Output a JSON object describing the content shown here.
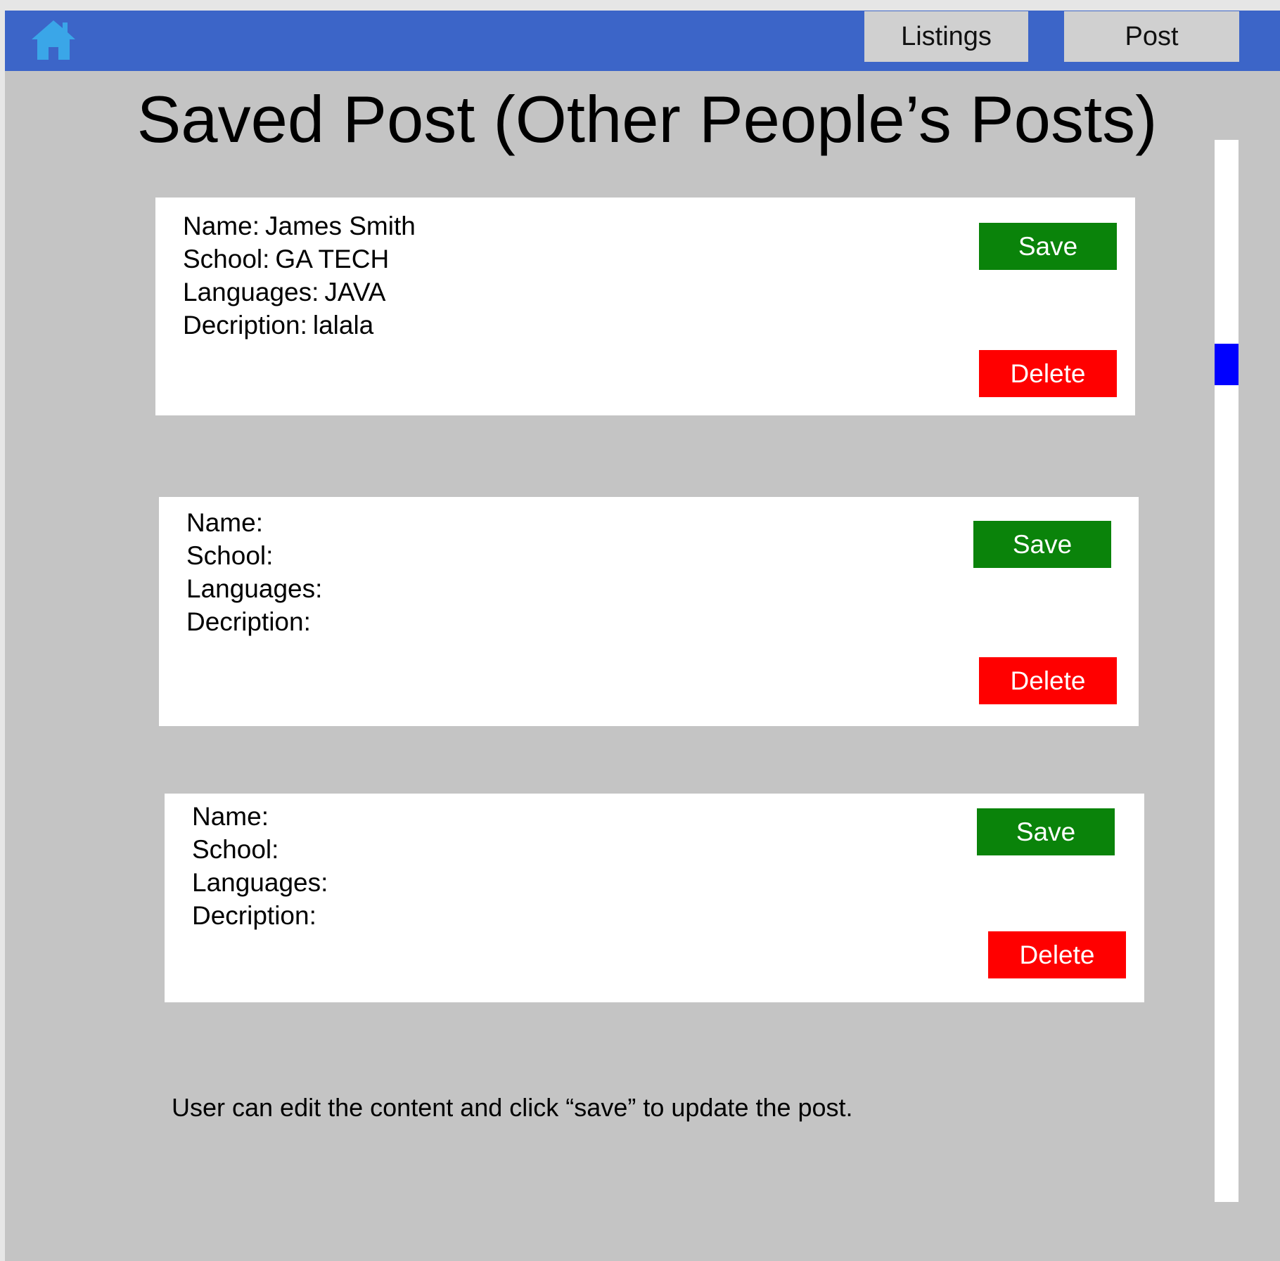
{
  "navbar": {
    "home_icon": "home-icon",
    "listings_label": "Listings",
    "post_label": "Post",
    "colors": {
      "bar": "#3c65c8",
      "button": "#d0d0d0",
      "home_icon": "#3aa6e8"
    }
  },
  "page": {
    "title": "Saved Post (Other People’s Posts)",
    "background": "#c4c4c4"
  },
  "posts": [
    {
      "fields": [
        {
          "label": "Name:",
          "value": "James Smith"
        },
        {
          "label": "School:",
          "value": "GA TECH"
        },
        {
          "label": "Languages:",
          "value": "JAVA"
        },
        {
          "label": "Decription:",
          "value": "lalala"
        }
      ],
      "save_label": "Save",
      "delete_label": "Delete"
    },
    {
      "fields": [
        {
          "label": "Name:",
          "value": ""
        },
        {
          "label": "School:",
          "value": ""
        },
        {
          "label": "Languages:",
          "value": ""
        },
        {
          "label": "Decription:",
          "value": ""
        }
      ],
      "save_label": "Save",
      "delete_label": "Delete"
    },
    {
      "fields": [
        {
          "label": "Name:",
          "value": ""
        },
        {
          "label": "School:",
          "value": ""
        },
        {
          "label": "Languages:",
          "value": ""
        },
        {
          "label": "Decription:",
          "value": ""
        }
      ],
      "save_label": "Save",
      "delete_label": "Delete"
    }
  ],
  "buttons": {
    "save_color": "#0a830a",
    "delete_color": "#ff0000"
  },
  "note": "User can edit the content and click “save” to  update the post.",
  "scrollbar": {
    "thumb_color": "#0000ff",
    "position_fraction": 0.2
  }
}
